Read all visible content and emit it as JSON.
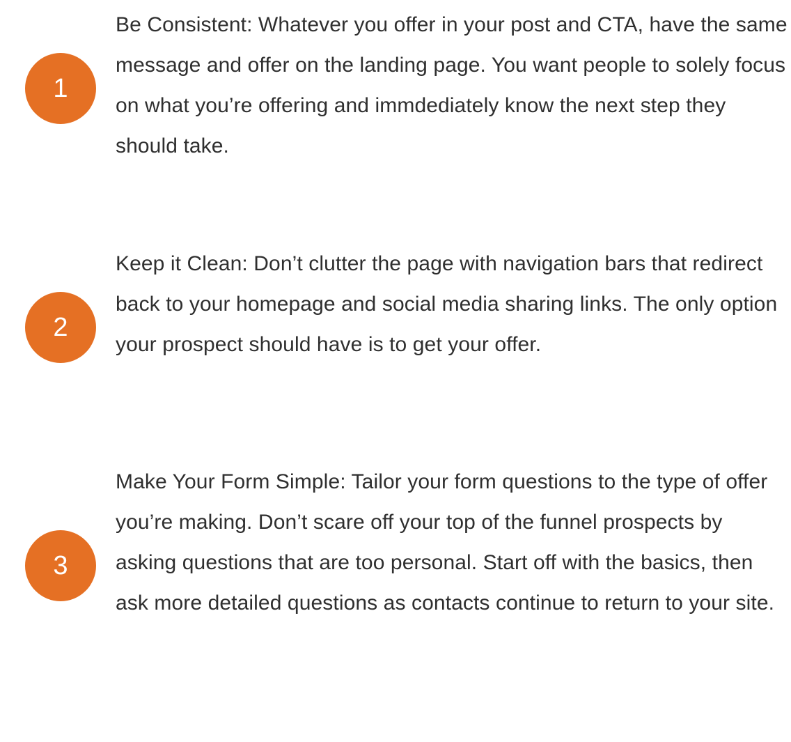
{
  "accent_color": "#e57024",
  "tips": [
    {
      "number": "1",
      "text": "Be Consistent: Whatever you offer in your post and CTA, have the same message and offer on the landing page. You want people to solely focus on what you’re offering and immdediately know the next step they should take."
    },
    {
      "number": "2",
      "text": "Keep it Clean: Don’t clutter the page with navigation bars that redirect back to your homepage and social media sharing links. The only option your prospect should have is to get your offer."
    },
    {
      "number": "3",
      "text": "Make Your Form Simple: Tailor your form questions to the type of offer you’re making. Don’t scare off your top of the funnel prospects by asking questions that are too personal. Start off with the basics, then ask more detailed questions as contacts continue to return to your site."
    }
  ]
}
